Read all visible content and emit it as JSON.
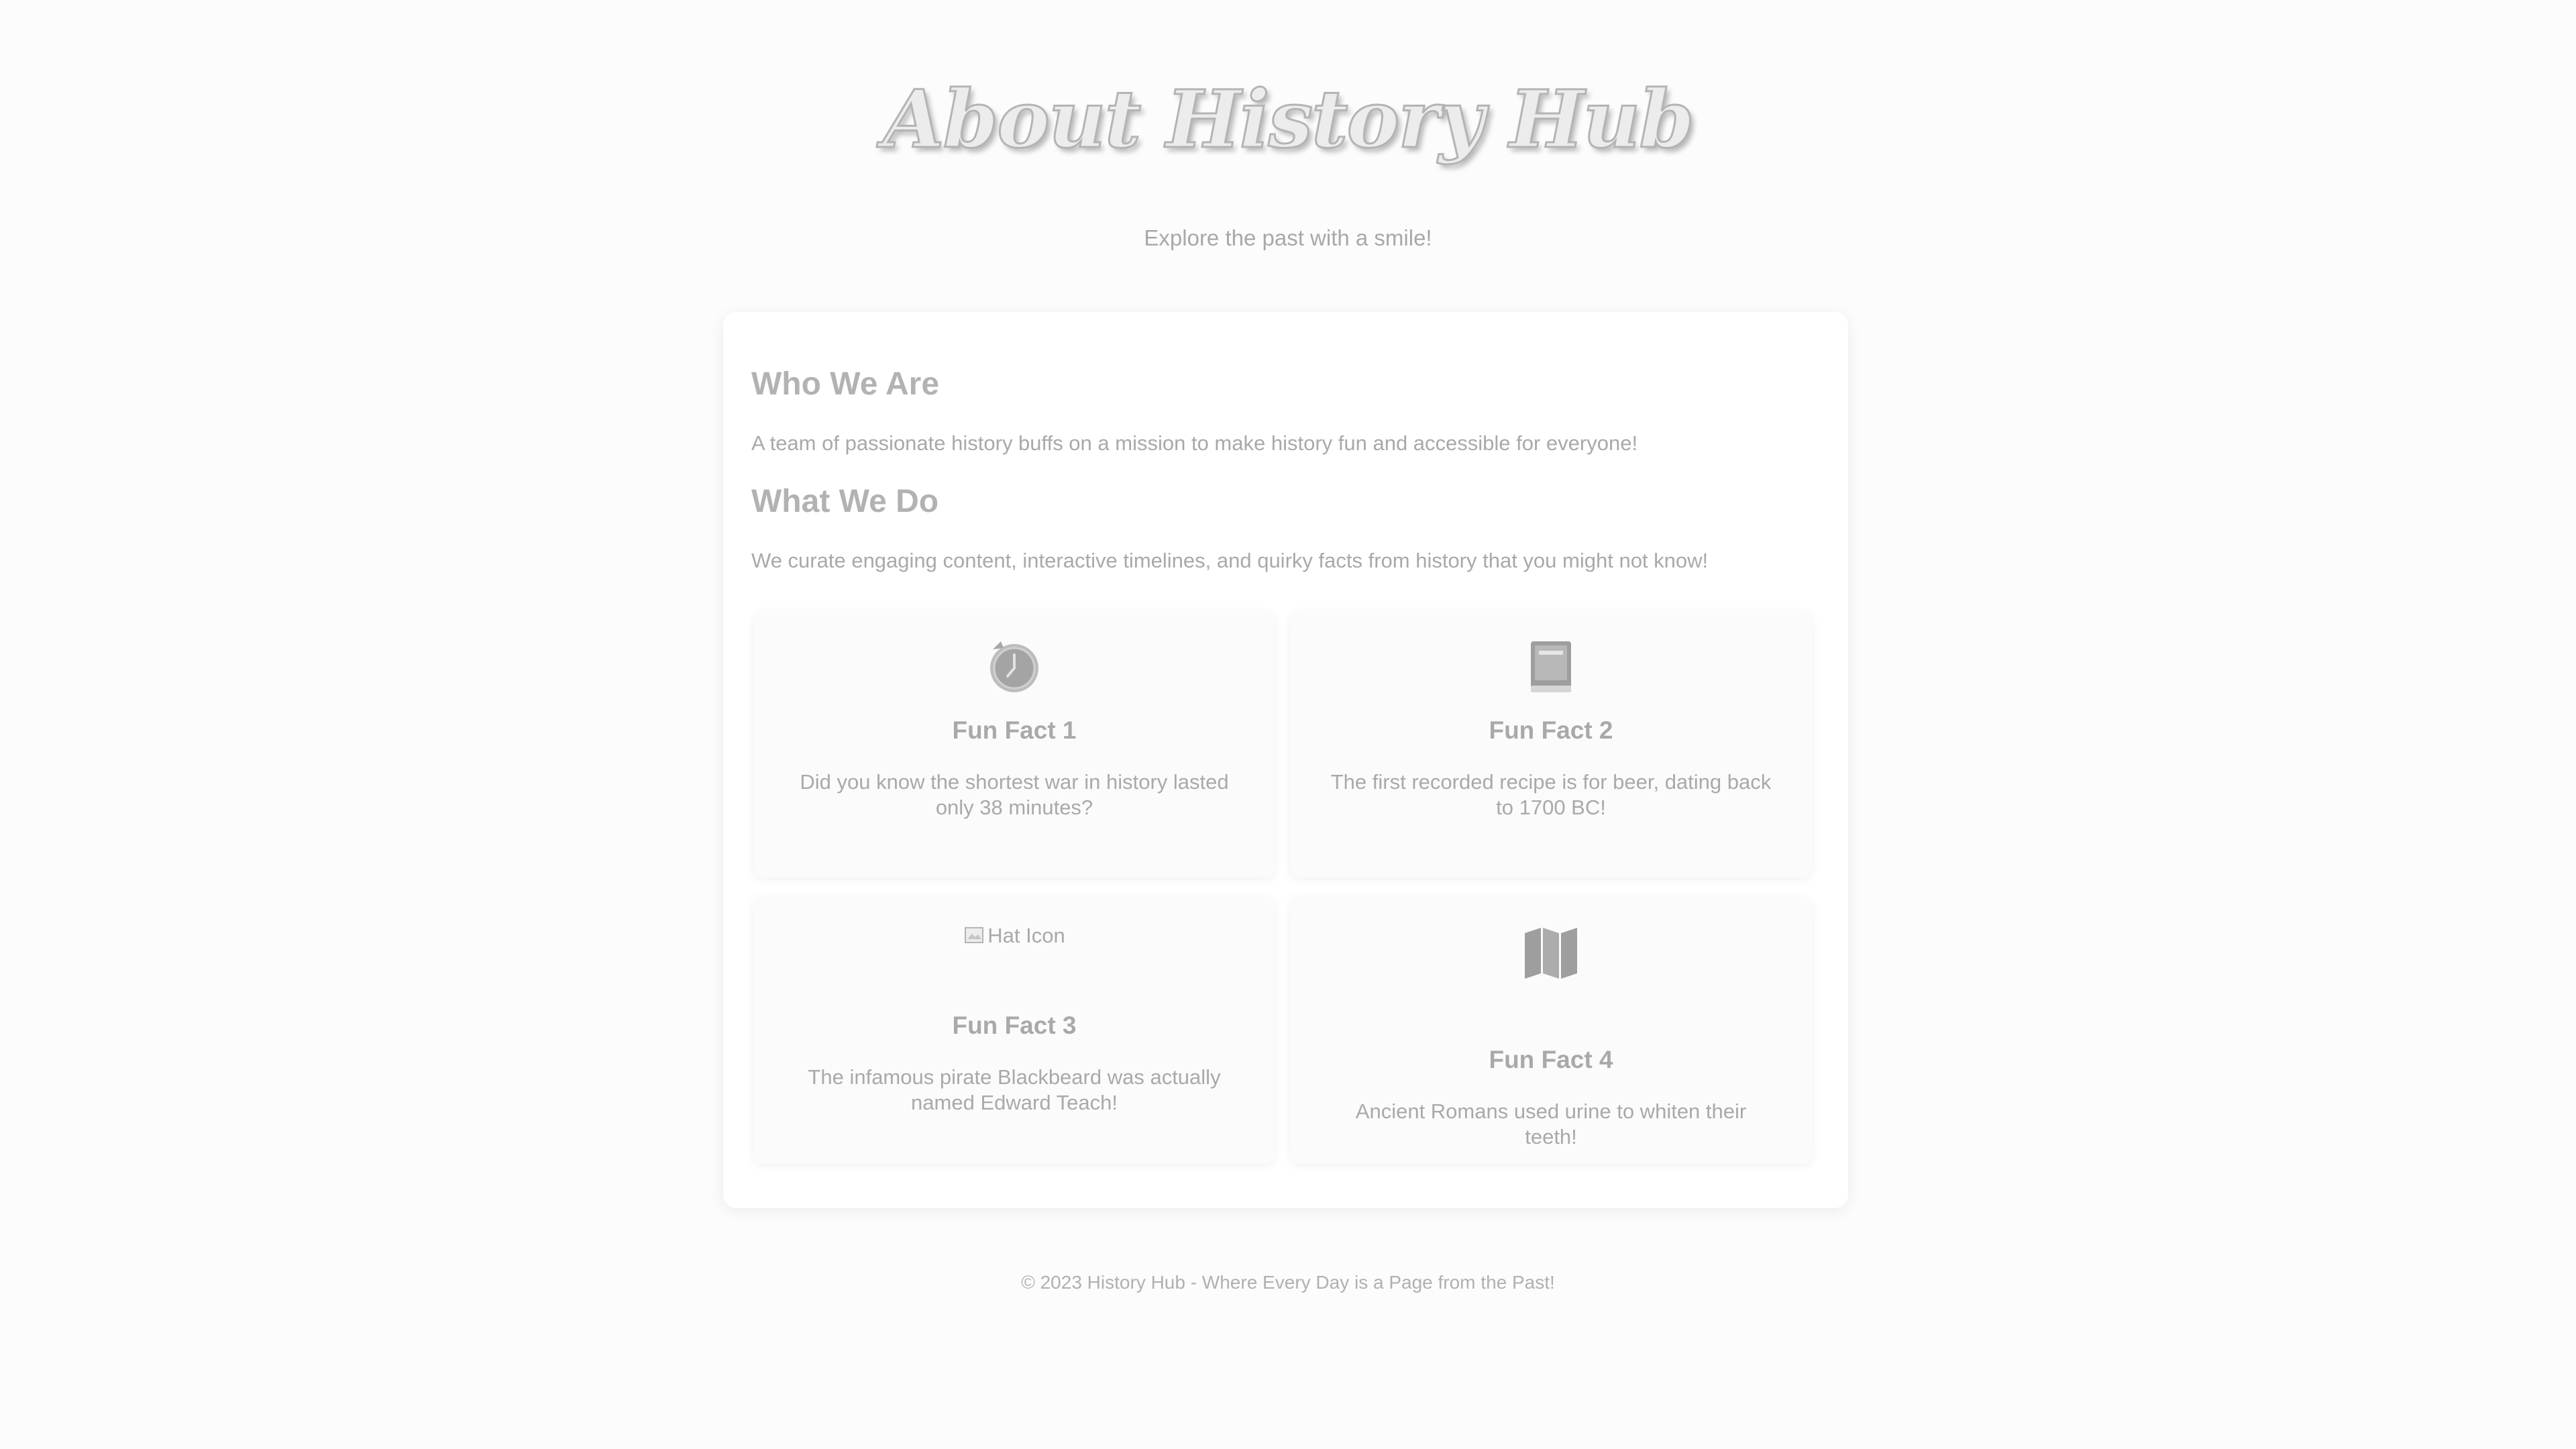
{
  "header": {
    "title": "About History Hub",
    "tagline": "Explore the past with a smile!"
  },
  "about": {
    "who_heading": "Who We Are",
    "who_text": "A team of passionate history buffs on a mission to make history fun and accessible for everyone!",
    "what_heading": "What We Do",
    "what_text": "We curate engaging content, interactive timelines, and quirky facts from history that you might not know!"
  },
  "facts": [
    {
      "icon": "clock-icon",
      "title": "Fun Fact 1",
      "text": "Did you know the shortest war in history lasted only 38 minutes?"
    },
    {
      "icon": "book-icon",
      "title": "Fun Fact 2",
      "text": "The first recorded recipe is for beer, dating back to 1700 BC!"
    },
    {
      "icon": "hat-icon",
      "icon_alt": "Hat Icon",
      "title": "Fun Fact 3",
      "text": "The infamous pirate Blackbeard was actually named Edward Teach!"
    },
    {
      "icon": "map-icon",
      "title": "Fun Fact 4",
      "text": "Ancient Romans used urine to whiten their teeth!"
    }
  ],
  "footer": {
    "text": "© 2023 History Hub - Where Every Day is a Page from the Past!"
  },
  "colors": {
    "background": "#fcfcfc",
    "card": "#ffffff",
    "text": "#a9a9a9",
    "icon": "#9e9e9e"
  }
}
